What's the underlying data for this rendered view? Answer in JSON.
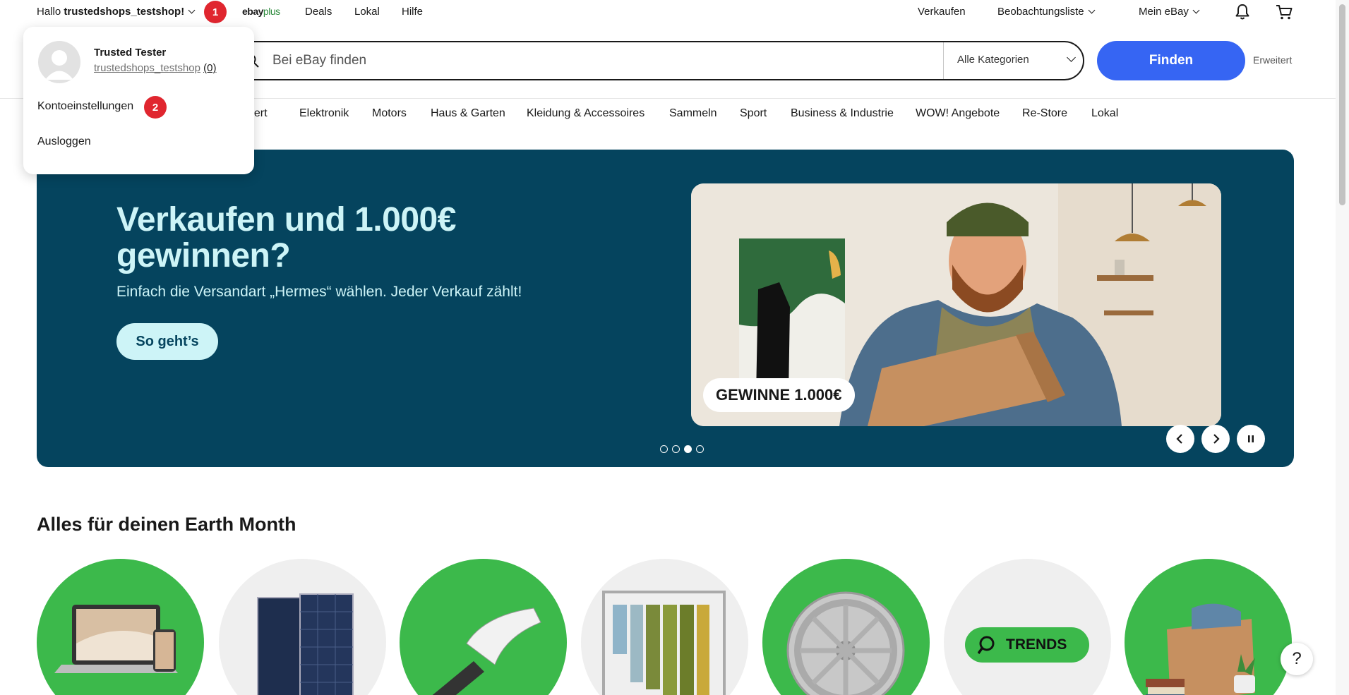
{
  "topbar": {
    "greeting_prefix": "Hallo ",
    "username": "trustedshops_testshop!",
    "badge_1": "1",
    "ebayplus_ebay": "ebay",
    "ebayplus_plus": "plus",
    "deals": "Deals",
    "lokal": "Lokal",
    "hilfe": "Hilfe",
    "verkaufen": "Verkaufen",
    "watchlist": "Beobachtungsliste",
    "my_ebay": "Mein eBay"
  },
  "dropdown": {
    "name": "Trusted Tester",
    "user_link": "trustedshops_testshop",
    "feedback": "(0)",
    "account_settings": "Kontoeinstellungen",
    "badge_2": "2",
    "logout": "Ausloggen"
  },
  "search": {
    "placeholder": "Bei eBay finden",
    "category": "Alle Kategorien",
    "find_label": "Finden",
    "advanced": "Erweitert"
  },
  "categories": [
    "chert",
    "Elektronik",
    "Motors",
    "Haus & Garten",
    "Kleidung & Accessoires",
    "Sammeln",
    "Sport",
    "Business & Industrie",
    "WOW! Angebote",
    "Re-Store",
    "Lokal"
  ],
  "hero": {
    "title": "Verkaufen und 1.000€ gewinnen?",
    "subtitle": "Einfach die Versandart „Hermes“ wählen. Jeder Verkauf zählt!",
    "button": "So geht’s",
    "tag": "GEWINNE 1.000€",
    "dots_total": 4,
    "dots_active_index": 3
  },
  "section": {
    "title": "Alles für deinen Earth Month",
    "trends_label": "TRENDS"
  },
  "help": "?",
  "colors": {
    "accent_blue": "#3665f3",
    "hero_bg": "#05445e",
    "hero_text": "#cdf4f7",
    "badge_red": "#e0262f",
    "circle_green": "#3cb94b"
  }
}
